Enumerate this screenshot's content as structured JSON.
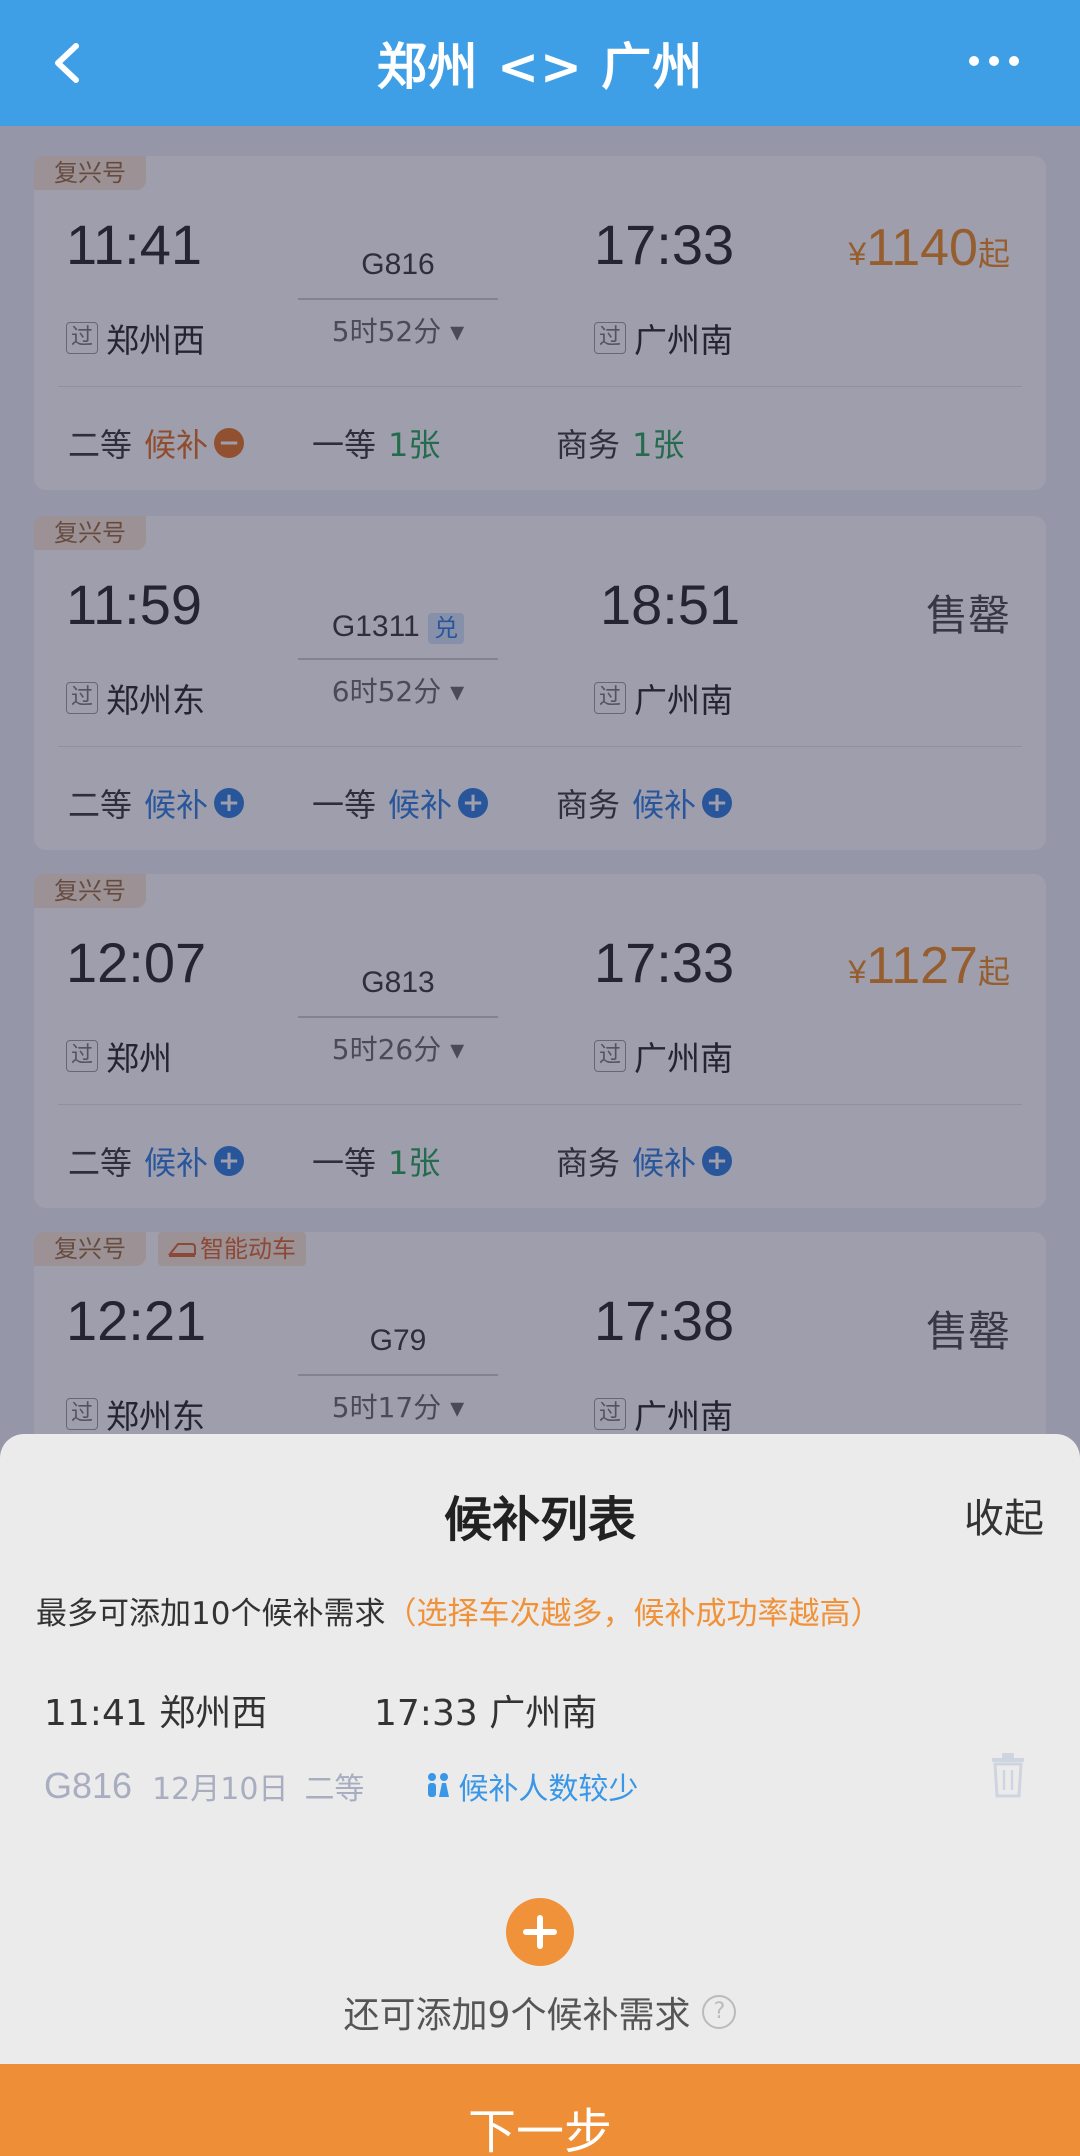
{
  "header": {
    "title": "郑州 <> 广州",
    "back_icon": "back-arrow-icon",
    "more_icon": "more-dots-icon"
  },
  "trains": [
    {
      "tags": [
        "复兴号"
      ],
      "depart_time": "11:41",
      "via": "过",
      "depart_station": "郑州西",
      "train_no": "G816",
      "duration": "5时52分",
      "arrive_time": "17:33",
      "arrive_station": "广州南",
      "price_currency": "¥",
      "price": "1140",
      "price_suffix": "起",
      "seats": [
        {
          "label": "二等",
          "value": "候补",
          "status": "minus"
        },
        {
          "label": "一等",
          "value": "1张",
          "status": "available"
        },
        {
          "label": "商务",
          "value": "1张",
          "status": "available"
        }
      ]
    },
    {
      "tags": [
        "复兴号"
      ],
      "depart_time": "11:59",
      "via": "过",
      "depart_station": "郑州东",
      "train_no": "G1311",
      "train_badge": "兑",
      "duration": "6时52分",
      "arrive_time": "18:51",
      "arrive_station": "广州南",
      "status": "售罄",
      "seats": [
        {
          "label": "二等",
          "value": "候补",
          "status": "plus"
        },
        {
          "label": "一等",
          "value": "候补",
          "status": "plus"
        },
        {
          "label": "商务",
          "value": "候补",
          "status": "plus"
        }
      ]
    },
    {
      "tags": [
        "复兴号"
      ],
      "depart_time": "12:07",
      "via": "过",
      "depart_station": "郑州",
      "train_no": "G813",
      "duration": "5时26分",
      "arrive_time": "17:33",
      "arrive_station": "广州南",
      "price_currency": "¥",
      "price": "1127",
      "price_suffix": "起",
      "seats": [
        {
          "label": "二等",
          "value": "候补",
          "status": "plus"
        },
        {
          "label": "一等",
          "value": "1张",
          "status": "available"
        },
        {
          "label": "商务",
          "value": "候补",
          "status": "plus"
        }
      ]
    },
    {
      "tags": [
        "复兴号",
        "智能动车"
      ],
      "depart_time": "12:21",
      "via": "过",
      "depart_station": "郑州东",
      "train_no": "G79",
      "duration": "5时17分",
      "arrive_time": "17:38",
      "arrive_station": "广州南",
      "status": "售罄"
    }
  ],
  "sheet": {
    "title": "候补列表",
    "collapse_label": "收起",
    "hint": "最多可添加10个候补需求",
    "hint_tip": "（选择车次越多，候补成功率越高）",
    "item": {
      "depart": "11:41 郑州西",
      "arrive": "17:33 广州南",
      "train_no": "G816",
      "date": "12月10日",
      "seat": "二等",
      "people_text": "候补人数较少"
    },
    "add_more": "还可添加9个候补需求",
    "help": "?"
  },
  "next_button": "下一步",
  "colors": {
    "header": "#3f9fe6",
    "price": "#f08a1c",
    "next": "#ee8f37",
    "blue": "#2a7de1",
    "green": "#23a455"
  }
}
